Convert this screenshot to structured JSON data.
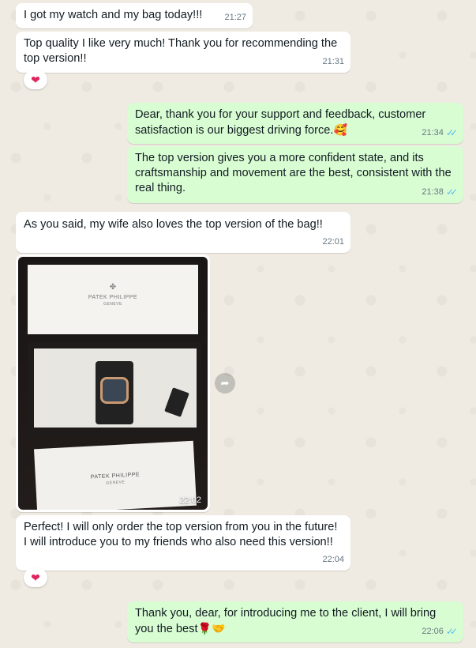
{
  "messages": {
    "m1": {
      "text": "I got my watch and my bag today!!!",
      "time": "21:27"
    },
    "m2": {
      "text": "Top quality I like very much! Thank you for recommending the top version!!",
      "time": "21:31",
      "reaction": "❤"
    },
    "m3": {
      "text": "Dear, thank you for your support and feedback, customer satisfaction is our biggest driving force.",
      "emoji": "🥰",
      "time": "21:34"
    },
    "m4": {
      "text": "The top version gives you a more confident state, and its craftsmanship and movement are the best, consistent with the real thing.",
      "time": "21:38"
    },
    "m5": {
      "text": "As you said, my wife also loves the top version of the bag!!",
      "time": "22:01"
    },
    "photo": {
      "time": "22:02",
      "brand_top": "PATEK PHILIPPE",
      "brand_sub": "GENEVE",
      "brand_bottom": "PATEK PHILIPPE",
      "brand_bottom_sub": "GENEVE"
    },
    "m6": {
      "text": "Perfect! I will only order the top version from you in the future! I will introduce you to my friends who also need this version!!",
      "time": "22:04",
      "reaction": "❤"
    },
    "m7": {
      "text": "Thank you, dear, for introducing me to the client, I will bring you the best",
      "emoji": "🌹🤝",
      "time": "22:06"
    }
  },
  "read_ticks": "✓✓",
  "colors": {
    "incoming": "#ffffff",
    "outgoing": "#d9fdd3",
    "background": "#efeae2",
    "tick": "#53bdeb"
  },
  "icons": {
    "forward": "forward-icon",
    "reaction": "heart-icon",
    "read": "double-check-icon"
  }
}
